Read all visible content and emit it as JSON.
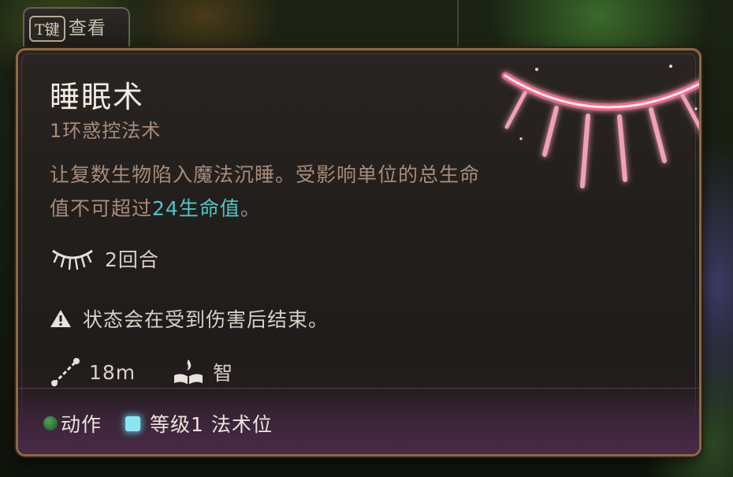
{
  "key_hint": {
    "key": "T键",
    "label": "查看"
  },
  "spell": {
    "name": "睡眠术",
    "type": "1环惑控法术",
    "description_part1": "让复数生物陷入魔法沉睡。受影响单位的总生命值不可超过",
    "description_highlight": "24生命值",
    "description_part2": "。",
    "duration": "2回合",
    "warning": "状态会在受到伤害后结束。",
    "range": "18m",
    "save_ability": "智"
  },
  "footer": {
    "action_label": "动作",
    "slot_label": "等级1 法术位"
  },
  "icons": {
    "duration": "closed-eye-icon",
    "warning": "warning-triangle-icon",
    "range": "range-icon",
    "save": "spellbook-save-icon",
    "art": "closed-eye-spell-art-icon"
  },
  "colors": {
    "highlight": "#4fc6c6",
    "border": "#8a6a44",
    "action_dot": "#2f7a3a",
    "slot": "#8ce6f2",
    "art_glow": "#e86a8a"
  }
}
